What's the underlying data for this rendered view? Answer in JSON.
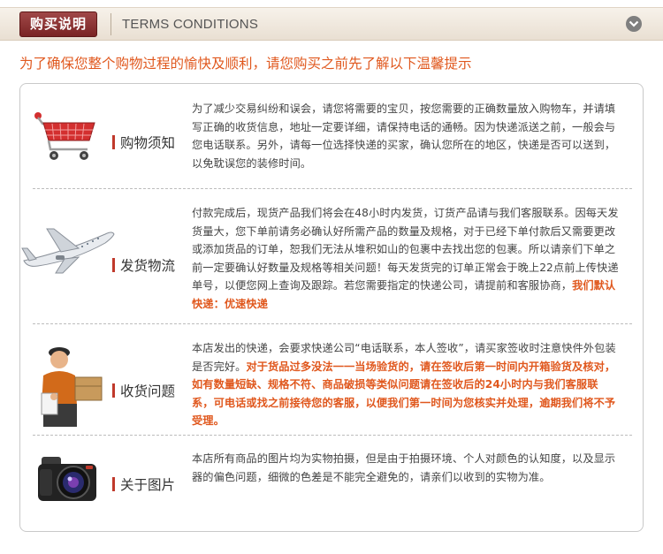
{
  "header": {
    "badge": "购买说明",
    "title": "TERMS CONDITIONS"
  },
  "intro": "为了确保您整个购物过程的愉快及顺利，请您购买之前先了解以下温馨提示",
  "colors": {
    "accent": "#e0581e",
    "badge": "#8b3030",
    "label_bar": "#c0392b"
  },
  "sections": [
    {
      "icon": "shopping-cart-icon",
      "label": "购物须知",
      "text": "为了减少交易纠纷和误会，请您将需要的宝贝，按您需要的正确数量放入购物车，并请填写正确的收货信息，地址一定要详细，请保持电话的通畅。因为快递派送之前，一般会与您电话联系。另外，请每一位选择快递的买家，确认您所在的地区，快递是否可以送到，以免耽误您的装修时间。"
    },
    {
      "icon": "airplane-icon",
      "label": "发货物流",
      "text": "付款完成后，现货产品我们将会在48小时内发货，订货产品请与我们客服联系。因每天发货量大，您下单前请务必确认好所需产品的数量及规格，对于已经下单付款后又需要更改或添加货品的订单，恕我们无法从堆积如山的包裹中去找出您的包裹。所以请亲们下单之前一定要确认好数量及规格等相关问题！每天发货完的订单正常会于晚上22点前上传快递单号，以便您网上查询及跟踪。若您需要指定的快递公司，请提前和客服协商，",
      "highlight": "我们默认快递：优速快递"
    },
    {
      "icon": "delivery-man-icon",
      "label": "收货问题",
      "text": "本店发出的快递，会要求快递公司“电话联系，本人签收”，请买家签收时注意快件外包装是否完好。",
      "highlight": "对于货品过多没法一一当场验货的，请在签收后第一时间内开箱验货及核对，如有数量短缺、规格不符、商品破损等类似问题请在签收后的24小时内与我们客服联系，可电话或找之前接待您的客服，以便我们第一时间为您核实并处理，逾期我们将不予受理。"
    },
    {
      "icon": "camera-icon",
      "label": "关于图片",
      "text": "本店所有商品的图片均为实物拍摄，但是由于拍摄环境、个人对颜色的认知度，以及显示器的偏色问题，细微的色差是不能完全避免的，请亲们以收到的实物为准。"
    }
  ]
}
